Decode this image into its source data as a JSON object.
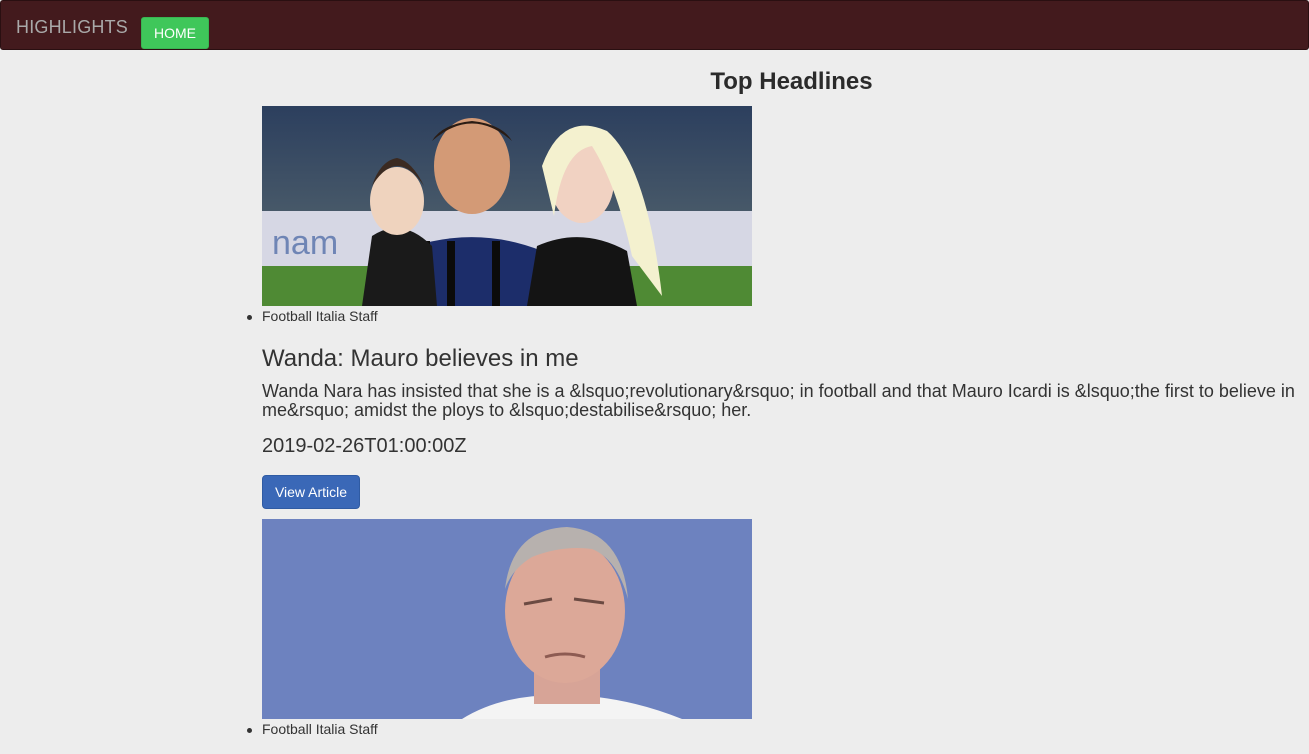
{
  "navbar": {
    "brand": "HIGHLIGHTS",
    "home_label": "HOME",
    "home_color": "#3fc75a",
    "background": "#431a1d"
  },
  "page_title": "Top Headlines",
  "articles": [
    {
      "author": "Football Italia Staff",
      "headline": "Wanda: Mauro believes in me",
      "description": "Wanda Nara has insisted that she is a &lsquo;revolutionary&rsquo; in football and that Mauro Icardi is &lsquo;the first to believe in me&rsquo; amidst the ploys to &lsquo;destabilise&rsquo; her.",
      "published_at": "2019-02-26T01:00:00Z",
      "button_label": "View Article"
    },
    {
      "author": "Football Italia Staff"
    }
  ]
}
